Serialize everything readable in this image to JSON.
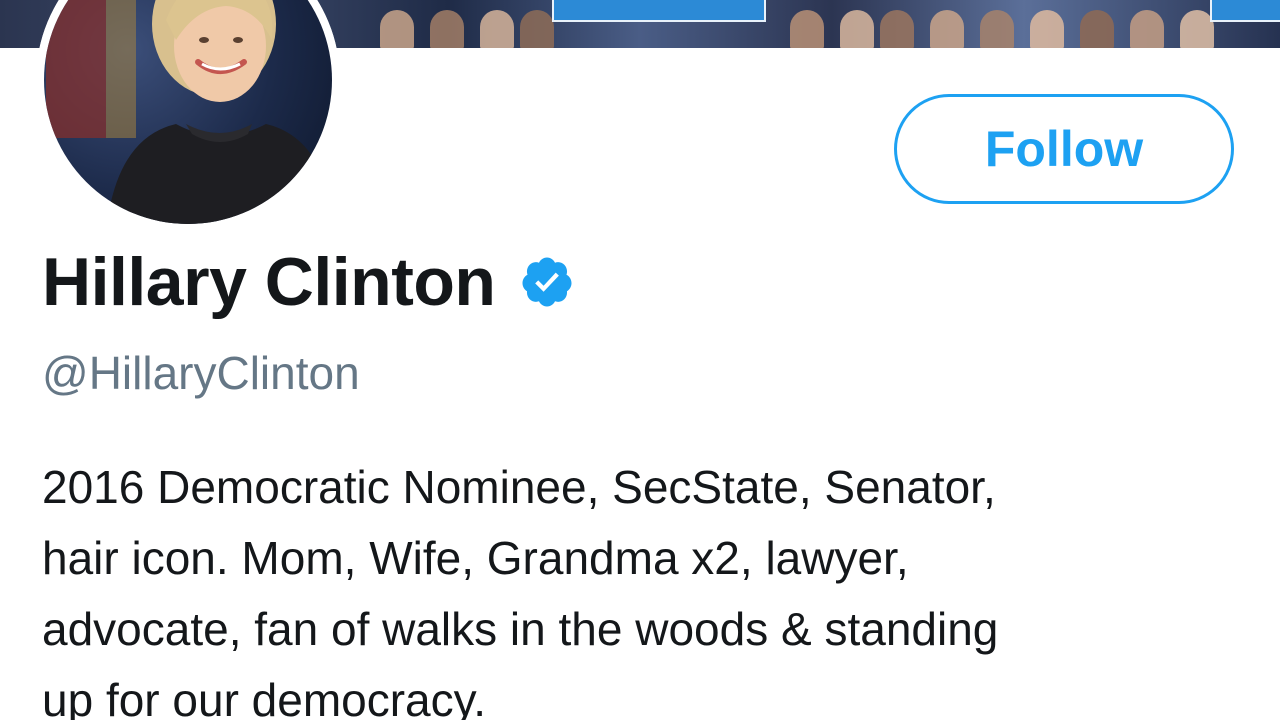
{
  "profile": {
    "display_name": "Hillary Clinton",
    "handle": "@HillaryClinton",
    "verified": true,
    "bio_lines": [
      "2016 Democratic Nominee, SecState, Senator,",
      "hair icon. Mom, Wife, Grandma x2, lawyer,",
      "advocate, fan of walks in the woods & standing",
      "up for our democracy."
    ]
  },
  "actions": {
    "follow_label": "Follow"
  },
  "colors": {
    "accent": "#1da1f2",
    "text_primary": "#14171a",
    "text_secondary": "#657786",
    "background": "#ffffff"
  },
  "icons": {
    "verified": "verified-badge-icon"
  }
}
